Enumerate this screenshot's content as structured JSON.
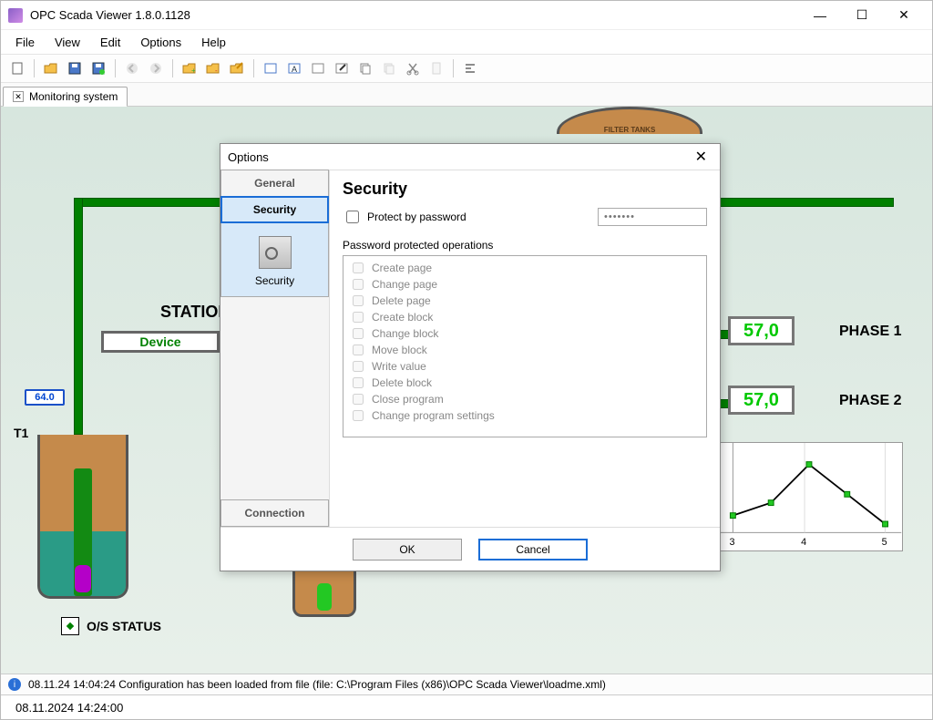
{
  "window": {
    "title": "OPC Scada Viewer 1.8.0.1128"
  },
  "menu": {
    "file": "File",
    "view": "View",
    "edit": "Edit",
    "options": "Options",
    "help": "Help"
  },
  "tabs": {
    "main": "Monitoring system"
  },
  "scada": {
    "station_label": "STATION",
    "device_label": "Device",
    "sensor_val": "64.0",
    "t1_label": "T1",
    "phase1_value": "57,0",
    "phase1_label": "PHASE 1",
    "phase2_value": "57,0",
    "phase2_label": "PHASE 2",
    "filter_label": "FILTER TANKS",
    "os_status": "O/S STATUS"
  },
  "chart_data": {
    "type": "line",
    "x": [
      3,
      3.5,
      4,
      4.5,
      5
    ],
    "y": [
      20,
      35,
      80,
      45,
      10
    ],
    "xticks": [
      "3",
      "4",
      "5"
    ],
    "ylim": [
      0,
      100
    ]
  },
  "dialog": {
    "title": "Options",
    "tabs": {
      "general": "General",
      "security": "Security",
      "connection": "Connection",
      "icon_label": "Security"
    },
    "heading": "Security",
    "protect_label": "Protect by password",
    "password_mask": "•••••••",
    "ops_label": "Password protected operations",
    "ops": [
      "Create page",
      "Change page",
      "Delete page",
      "Create block",
      "Change block",
      "Move block",
      "Write value",
      "Delete block",
      "Close program",
      "Change program settings"
    ],
    "ok": "OK",
    "cancel": "Cancel"
  },
  "info": {
    "msg": "08.11.24 14:04:24 Configuration has been loaded from file (file: C:\\Program Files (x86)\\OPC Scada Viewer\\loadme.xml)"
  },
  "status": {
    "datetime": "08.11.2024 14:24:00"
  }
}
